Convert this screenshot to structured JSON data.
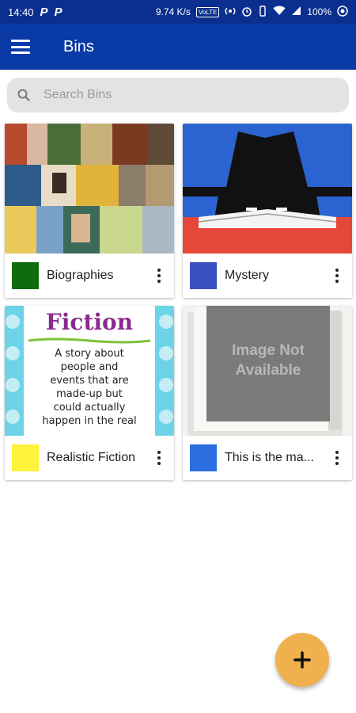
{
  "status_bar": {
    "time": "14:40",
    "speed": "9.74 K/s",
    "volte": "VoLTE",
    "battery": "100%"
  },
  "app_bar": {
    "title": "Bins",
    "menu_icon": "hamburger-menu-icon"
  },
  "search": {
    "placeholder": "Search Bins",
    "value": ""
  },
  "bins": [
    {
      "label": "Biographies",
      "color": "#0e6b0e",
      "thumbnail": "book-covers-collage"
    },
    {
      "label": "Mystery",
      "color": "#3a4fc0",
      "thumbnail": "hat-figure-reading"
    },
    {
      "label": "Realistic Fiction",
      "color": "#fff23a",
      "thumbnail": "fiction-poster",
      "thumb_text": {
        "title": "Fiction",
        "body": [
          "A story about",
          "people and",
          "events that are",
          "made-up but",
          "could actually",
          "happen in the real"
        ]
      }
    },
    {
      "label": "This is the ma...",
      "color": "#2a6ee0",
      "thumbnail": "image-not-available",
      "thumb_text": {
        "line1": "Image Not",
        "line2": "Available"
      }
    }
  ],
  "fab": {
    "icon": "plus-icon"
  },
  "colors": {
    "primary": "#0a3aa6",
    "status_bar": "#0a2f8f",
    "accent": "#f0b04d"
  }
}
